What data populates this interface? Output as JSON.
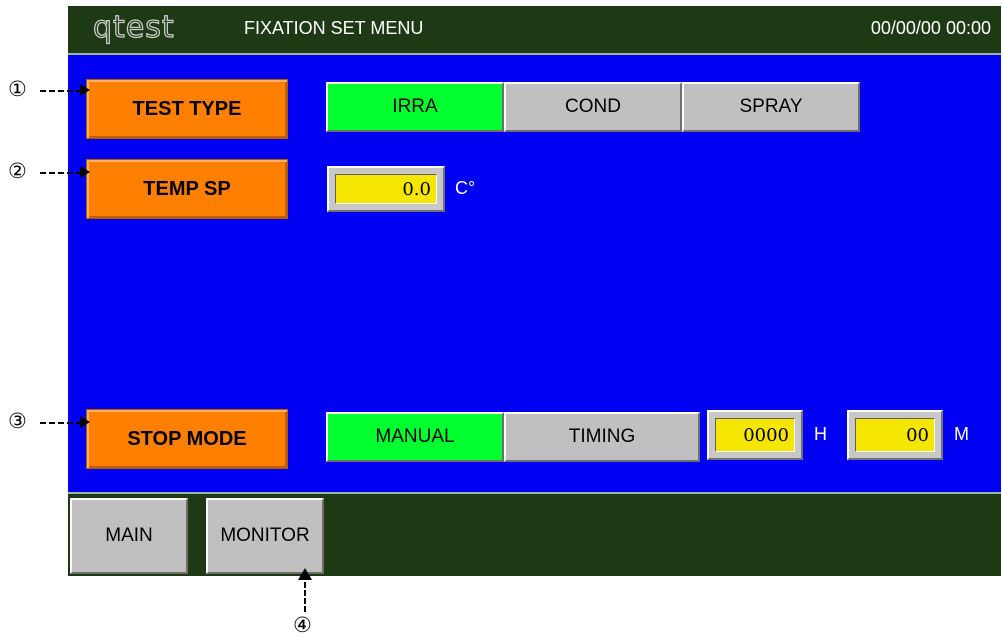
{
  "header": {
    "logo": "qtest",
    "title": "FIXATION SET MENU",
    "datetime": "00/00/00 00:00"
  },
  "test_type": {
    "label": "TEST TYPE",
    "options": [
      "IRRA",
      "COND",
      "SPRAY"
    ],
    "selected": "IRRA"
  },
  "temp_sp": {
    "label": "TEMP SP",
    "value": "0.0",
    "unit": "C°"
  },
  "stop_mode": {
    "label": "STOP MODE",
    "options": [
      "MANUAL",
      "TIMING"
    ],
    "selected": "MANUAL",
    "hours": "0000",
    "hours_unit": "H",
    "minutes": "00",
    "minutes_unit": "M"
  },
  "footer": {
    "main_label": "MAIN",
    "monitor_label": "MONITOR"
  },
  "callouts": [
    "①",
    "②",
    "③",
    "④"
  ],
  "colors": {
    "background": "#0000f2",
    "header": "#1e3a14",
    "label": "#ff7f00",
    "selected": "#00ff2e",
    "button": "#c0c0c0",
    "input": "#f5e600"
  }
}
